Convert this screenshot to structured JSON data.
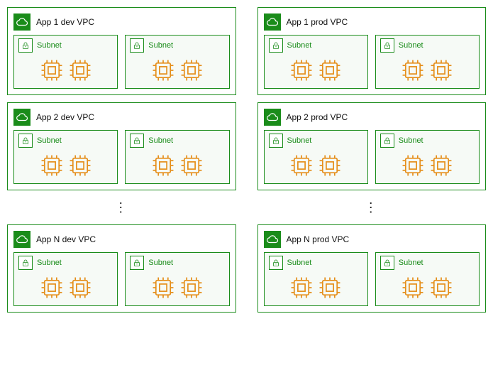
{
  "subnet_label": "Subnet",
  "ellipsis": "⋮",
  "vpcs": [
    {
      "title": "App 1  dev VPC"
    },
    {
      "title": "App 1 prod VPC"
    },
    {
      "title": "App 2  dev VPC"
    },
    {
      "title": "App 2 prod VPC"
    },
    {
      "title": "App N  dev VPC"
    },
    {
      "title": "App N prod VPC"
    }
  ],
  "colors": {
    "vpc_green": "#1a8c1a",
    "chip_orange": "#e58e1a",
    "subnet_bg": "#f6faf6"
  }
}
